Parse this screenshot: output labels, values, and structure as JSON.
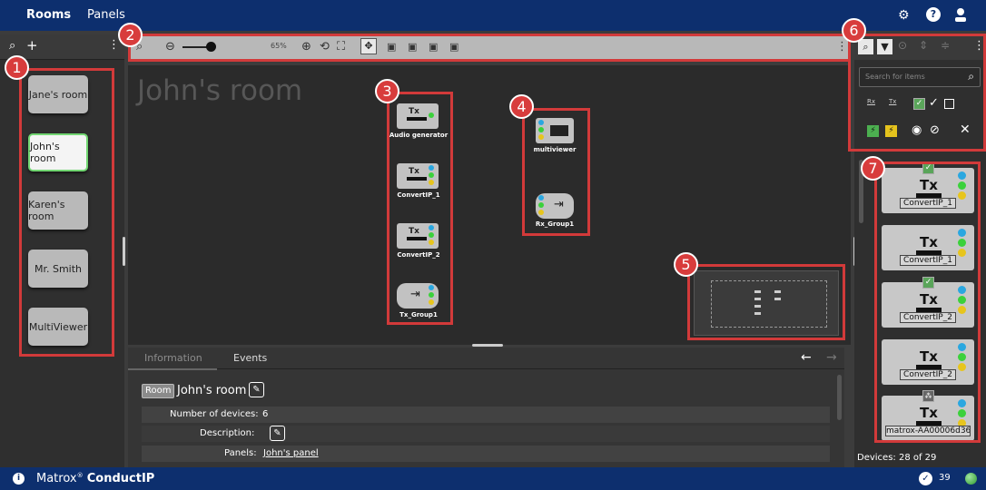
{
  "topbar": {
    "tab_rooms": "Rooms",
    "tab_panels": "Panels",
    "icons": [
      "gear-icon",
      "help-icon",
      "user-icon"
    ]
  },
  "left": {
    "rooms": [
      "Jane's room",
      "John's room",
      "Karen's room",
      "Mr. Smith",
      "MultiViewer"
    ],
    "active_room": "John's room"
  },
  "toolbar": {
    "zoom": "65%"
  },
  "canvas": {
    "title": "John's room",
    "group3": [
      "Audio generator",
      "ConvertIP_1",
      "ConvertIP_2",
      "Tx_Group1"
    ],
    "group4": [
      "multiviewer",
      "Rx_Group1"
    ],
    "tx_label": "Tx"
  },
  "badges": [
    "1",
    "2",
    "3",
    "4",
    "5",
    "6",
    "7"
  ],
  "info": {
    "tab_information": "Information",
    "tab_events": "Events",
    "room_tag": "Room",
    "room_name": "John's room",
    "devices_label": "Number of devices:",
    "devices_value": "6",
    "description_label": "Description:",
    "panels_label": "Panels:",
    "panels_value": "John's panel"
  },
  "right": {
    "search_placeholder": "Search for items",
    "filter_rx": "Rx",
    "filter_tx": "Tx",
    "cards": [
      "ConvertIP_1",
      "ConvertIP_1",
      "ConvertIP_2",
      "ConvertIP_2",
      "matrox-AA00006d36"
    ],
    "card_tx": "Tx",
    "devices_count": "Devices: 28 of 29"
  },
  "footer": {
    "brand": "Matrox ConductIP",
    "brand_prefix": "Matrox",
    "brand_suffix": "ConductIP",
    "count": "39"
  },
  "colors": {
    "accent": "#0d2f6e",
    "highlight": "#d23a3a",
    "active_border": "#72d672"
  }
}
